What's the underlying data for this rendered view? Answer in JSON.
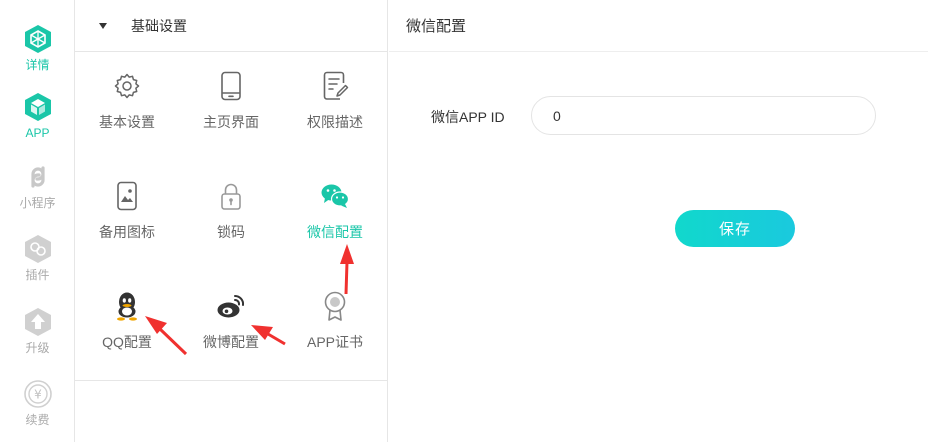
{
  "rail": {
    "items": [
      {
        "label": "详情",
        "icon": "cube-icon",
        "active": true
      },
      {
        "label": "APP",
        "icon": "cube-icon",
        "active": true
      },
      {
        "label": "小程序",
        "icon": "miniprogram-icon",
        "active": false
      },
      {
        "label": "插件",
        "icon": "plugin-icon",
        "active": false
      },
      {
        "label": "升级",
        "icon": "upgrade-icon",
        "active": false
      },
      {
        "label": "续费",
        "icon": "renew-icon",
        "active": false
      }
    ]
  },
  "middle": {
    "section_title": "基础设置",
    "items": [
      {
        "label": "基本设置",
        "icon": "gear-icon"
      },
      {
        "label": "主页界面",
        "icon": "phone-icon"
      },
      {
        "label": "权限描述",
        "icon": "edit-doc-icon"
      },
      {
        "label": "备用图标",
        "icon": "image-phone-icon"
      },
      {
        "label": "锁码",
        "icon": "lock-icon"
      },
      {
        "label": "微信配置",
        "icon": "wechat-icon",
        "active": true
      },
      {
        "label": "QQ配置",
        "icon": "qq-icon"
      },
      {
        "label": "微博配置",
        "icon": "weibo-icon"
      },
      {
        "label": "APP证书",
        "icon": "certificate-icon"
      }
    ]
  },
  "right": {
    "title": "微信配置",
    "field_label": "微信APP ID",
    "field_value": "0",
    "save_label": "保存"
  },
  "colors": {
    "accent": "#1ac6a8",
    "button": "#11d8cc",
    "arrow": "#f0312f",
    "muted": "#aaaaaa"
  }
}
